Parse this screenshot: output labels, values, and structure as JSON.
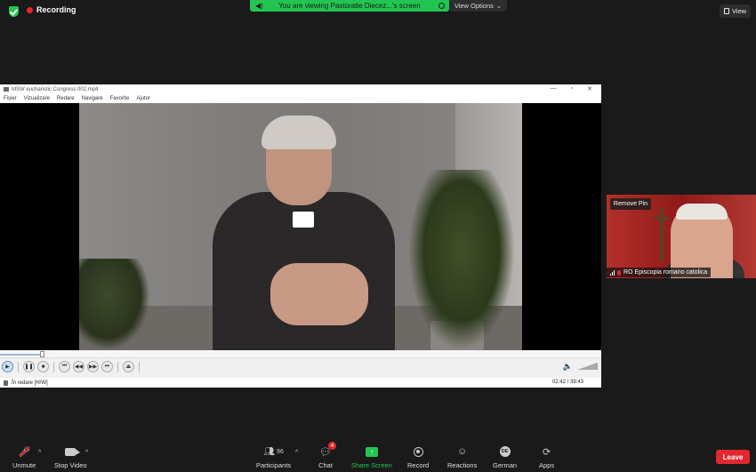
{
  "topbar": {
    "recording_label": "Recording",
    "viewing_text": "You are viewing Pastoratie Diecez...'s screen",
    "view_options_label": "View Options",
    "view_button_label": "View"
  },
  "player": {
    "title": "MSW eucharistic Congress 002.mp4",
    "menu": [
      "Fișier",
      "Vizualizare",
      "Redare",
      "Navigare",
      "Favorite",
      "Ajutor"
    ],
    "status_text": "În redare [H/W]",
    "time_text": "02:42 / 39:43",
    "progress_fraction": 0.07
  },
  "pinned": {
    "remove_pin_label": "Remove Pin",
    "name": "RO Episcopia romano catolica"
  },
  "toolbar": {
    "unmute": "Unmute",
    "stop_video": "Stop Video",
    "participants": "Participants",
    "participants_count": "96",
    "chat": "Chat",
    "chat_badge": "4",
    "share_screen": "Share Screen",
    "record": "Record",
    "reactions": "Reactions",
    "language": "German",
    "language_code": "DE",
    "apps": "Apps",
    "leave": "Leave"
  },
  "colors": {
    "accent_green": "#23c552",
    "leave_red": "#e0282e",
    "background": "#1a1a1a"
  }
}
